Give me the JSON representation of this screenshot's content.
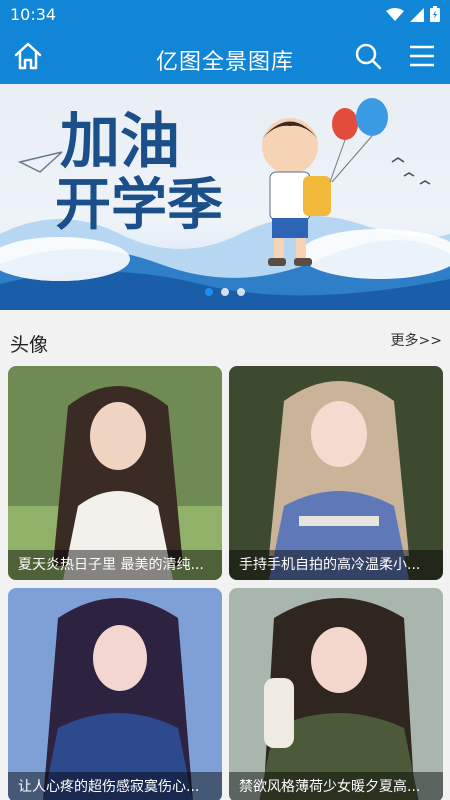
{
  "status_bar": {
    "time": "10:34"
  },
  "app_bar": {
    "title": "亿图全景图库"
  },
  "banner": {
    "headline_line1": "加油",
    "headline_line2": "开学季",
    "slide_count": 3,
    "active_slide": 1
  },
  "section": {
    "title": "头像",
    "more_label": "更多>>",
    "items": [
      {
        "caption": "夏天炎热日子里 最美的清纯..."
      },
      {
        "caption": "手持手机自拍的高冷温柔小..."
      },
      {
        "caption": "让人心疼的超伤感寂寞伤心..."
      },
      {
        "caption": "禁欲风格薄荷少女暖夕夏高..."
      }
    ]
  },
  "colors": {
    "primary": "#1286d6",
    "background": "#f2f2f2"
  }
}
